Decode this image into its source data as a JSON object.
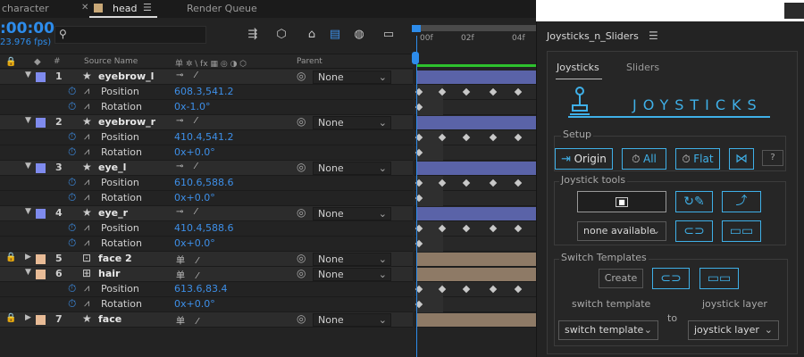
{
  "tabs": [
    {
      "label": "character",
      "active": false
    },
    {
      "label": "head",
      "active": true
    },
    {
      "label": "Render Queue",
      "active": false
    }
  ],
  "timecode": ":00:00",
  "fps": "23.976 fps)",
  "search": {
    "placeholder": ""
  },
  "columns": {
    "hash": "#",
    "source_name": "Source Name",
    "switches": "单 ✲ \\ fx ▦ ◎ ◑ ⬡",
    "parent": "Parent"
  },
  "ruler": {
    "labels": [
      "00f",
      "02f",
      "04f"
    ]
  },
  "layers": [
    {
      "num": "1",
      "name": "eyebrow_l",
      "color": "#7f8bee",
      "type_icon": "star",
      "switches": "⊸ ⁄",
      "parent": "None",
      "locked": false,
      "expanded": true,
      "props": [
        {
          "name": "Position",
          "value": "608.3,541.2"
        },
        {
          "name": "Rotation",
          "value": "0x-1.0°"
        }
      ]
    },
    {
      "num": "2",
      "name": "eyebrow_r",
      "color": "#7f8bee",
      "type_icon": "star",
      "switches": "⊸ ⁄",
      "parent": "None",
      "locked": false,
      "expanded": true,
      "props": [
        {
          "name": "Position",
          "value": "410.4,541.2"
        },
        {
          "name": "Rotation",
          "value": "0x+0.0°"
        }
      ]
    },
    {
      "num": "3",
      "name": "eye_l",
      "color": "#7f8bee",
      "type_icon": "star",
      "switches": "⊸ ⁄",
      "parent": "None",
      "locked": false,
      "expanded": true,
      "props": [
        {
          "name": "Position",
          "value": "610.6,588.6"
        },
        {
          "name": "Rotation",
          "value": "0x+0.0°"
        }
      ]
    },
    {
      "num": "4",
      "name": "eye_r",
      "color": "#7f8bee",
      "type_icon": "star",
      "switches": "⊸ ⁄",
      "parent": "None",
      "locked": false,
      "expanded": true,
      "props": [
        {
          "name": "Position",
          "value": "410.4,588.6"
        },
        {
          "name": "Rotation",
          "value": "0x+0.0°"
        }
      ]
    },
    {
      "num": "5",
      "name": "face 2",
      "color": "#e8bb96",
      "type_icon": "comp",
      "switches": "单 ⁄",
      "parent": "None",
      "locked": true,
      "expanded": false,
      "props": []
    },
    {
      "num": "6",
      "name": "hair",
      "color": "#e8bb96",
      "type_icon": "comp2",
      "switches": "单 ⁄",
      "parent": "None",
      "locked": false,
      "expanded": true,
      "props": [
        {
          "name": "Position",
          "value": "613.6,83.4"
        },
        {
          "name": "Rotation",
          "value": "0x+0.0°"
        }
      ]
    },
    {
      "num": "7",
      "name": "face",
      "color": "#e8bb96",
      "type_icon": "star",
      "switches": "单 ⁄",
      "parent": "None",
      "locked": true,
      "expanded": false,
      "props": []
    }
  ],
  "panel": {
    "title": "Joysticks_n_Sliders",
    "tabs": [
      "Joysticks",
      "Sliders"
    ],
    "header": "JOYSTICKS",
    "setup": {
      "label": "Setup",
      "origin": "Origin",
      "all": "All",
      "flat": "Flat",
      "help": "?"
    },
    "tools": {
      "label": "Joystick tools",
      "dropdown": "none available"
    },
    "switch": {
      "label": "Switch Templates",
      "create": "Create",
      "template_label": "switch template",
      "to": "to",
      "layer_label": "joystick layer",
      "template_dd": "switch template",
      "layer_dd": "joystick layer"
    }
  },
  "colors": {
    "accent": "#2d8ceb",
    "panel_accent": "#3fb0e8",
    "layer_blue": "#5a63a8",
    "layer_tan": "#8e7a66"
  }
}
